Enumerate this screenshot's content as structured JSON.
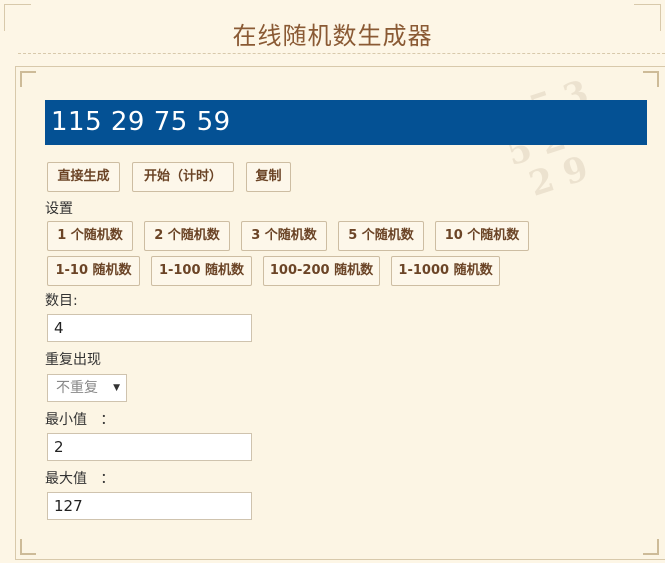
{
  "header": {
    "title": "在线随机数生成器"
  },
  "result": {
    "text": "115 29 75 59"
  },
  "actions": {
    "generate": "直接生成",
    "start_timer": "开始（计时）",
    "copy": "复制"
  },
  "settings": {
    "label": "设置",
    "count_presets": [
      "1 个随机数",
      "2 个随机数",
      "3 个随机数",
      "5 个随机数",
      "10 个随机数"
    ],
    "range_presets": [
      "1-10 随机数",
      "1-100 随机数",
      "100-200 随机数",
      "1-1000 随机数"
    ]
  },
  "form": {
    "count_label": "数目:",
    "count_value": "4",
    "repeat_label": "重复出现",
    "repeat_value": "不重复",
    "min_label": "最小值   ：",
    "min_value": "2",
    "max_label": "最大值   ：",
    "max_value": "127"
  },
  "colors": {
    "result_bg": "#045194",
    "page_bg": "#fdf6e6",
    "accent_text": "#8a5a34"
  }
}
